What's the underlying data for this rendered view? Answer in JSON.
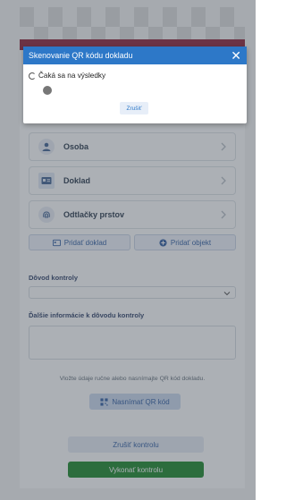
{
  "dialog": {
    "title": "Skenovanie QR kódu dokladu",
    "status": "Čaká sa na výsledky",
    "cancel_label": "Zrušiť",
    "close_icon": "close-icon"
  },
  "items": [
    {
      "label": "Osoba",
      "icon": "person-icon"
    },
    {
      "label": "Doklad",
      "icon": "id-card-icon"
    },
    {
      "label": "Odtlačky prstov",
      "icon": "fingerprint-icon"
    }
  ],
  "actions": {
    "add_document": "Pridať doklad",
    "add_object": "Pridať objekt"
  },
  "form": {
    "reason_label": "Dôvod kontroly",
    "reason_value": "",
    "details_label": "Ďalšie informácie k dôvodu kontroly",
    "details_value": ""
  },
  "scan": {
    "hint": "Vložte údaje ručne alebo nasnímajte QR kód dokladu.",
    "button": "Nasnímať QR kód"
  },
  "footer": {
    "cancel": "Zrušiť kontrolu",
    "submit": "Vykonať kontrolu"
  },
  "colors": {
    "dialog_header": "#2d78c8",
    "submit_green": "#178526",
    "brand_strip": "#8a1c33"
  }
}
